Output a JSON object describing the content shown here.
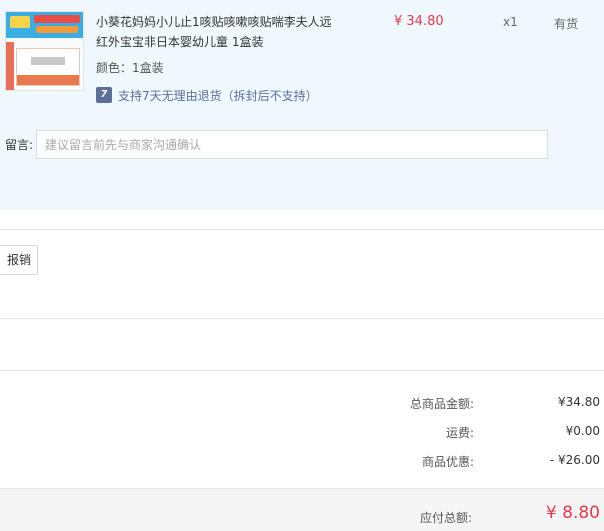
{
  "product": {
    "name": "小葵花妈妈小儿止1咳贴咳嗽咳贴喘李夫人远红外宝宝非日本婴幼儿童 1盒装",
    "price": "¥ 34.80",
    "quantity": "x1",
    "stock_status": "有货",
    "color_text": "颜色：1盒装",
    "return_icon": "7",
    "return_text": "支持7天无理由退货（拆封后不支持）"
  },
  "message": {
    "label": "留言:",
    "placeholder": "建议留言前先与商家沟通确认"
  },
  "invoice": {
    "button_label": "报销"
  },
  "summary": {
    "goods_label": "总商品金额:",
    "goods_value": "¥34.80",
    "shipping_label": "运费:",
    "shipping_value": "¥0.00",
    "discount_label": "商品优惠:",
    "discount_value": "- ¥26.00",
    "total_label": "应付总额:",
    "total_value": "¥ 8.80"
  },
  "colors": {
    "accent_red": "#e8384e",
    "panel_bg": "#eef8fd",
    "return_blue": "#5b6f99"
  }
}
